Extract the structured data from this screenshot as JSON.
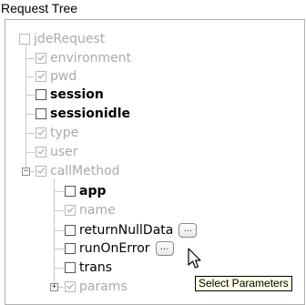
{
  "panel": {
    "title": "Request Tree"
  },
  "tree": {
    "root": {
      "label": "jdeRequest"
    },
    "children": [
      {
        "label": "environment",
        "style": "gray"
      },
      {
        "label": "pwd",
        "style": "gray"
      },
      {
        "label": "session",
        "style": "bold"
      },
      {
        "label": "sessionidle",
        "style": "bold"
      },
      {
        "label": "type",
        "style": "gray"
      },
      {
        "label": "user",
        "style": "gray"
      }
    ],
    "callMethod": {
      "label": "callMethod",
      "expander": "−",
      "children": [
        {
          "label": "app",
          "style": "bold"
        },
        {
          "label": "name",
          "style": "gray"
        },
        {
          "label": "returnNullData",
          "style": "normal",
          "button": "..."
        },
        {
          "label": "runOnError",
          "style": "normal",
          "button": "..."
        },
        {
          "label": "trans",
          "style": "normal"
        },
        {
          "label": "params",
          "style": "gray",
          "expander": "+"
        }
      ]
    }
  },
  "tooltip": {
    "text": "Select Parameters"
  }
}
